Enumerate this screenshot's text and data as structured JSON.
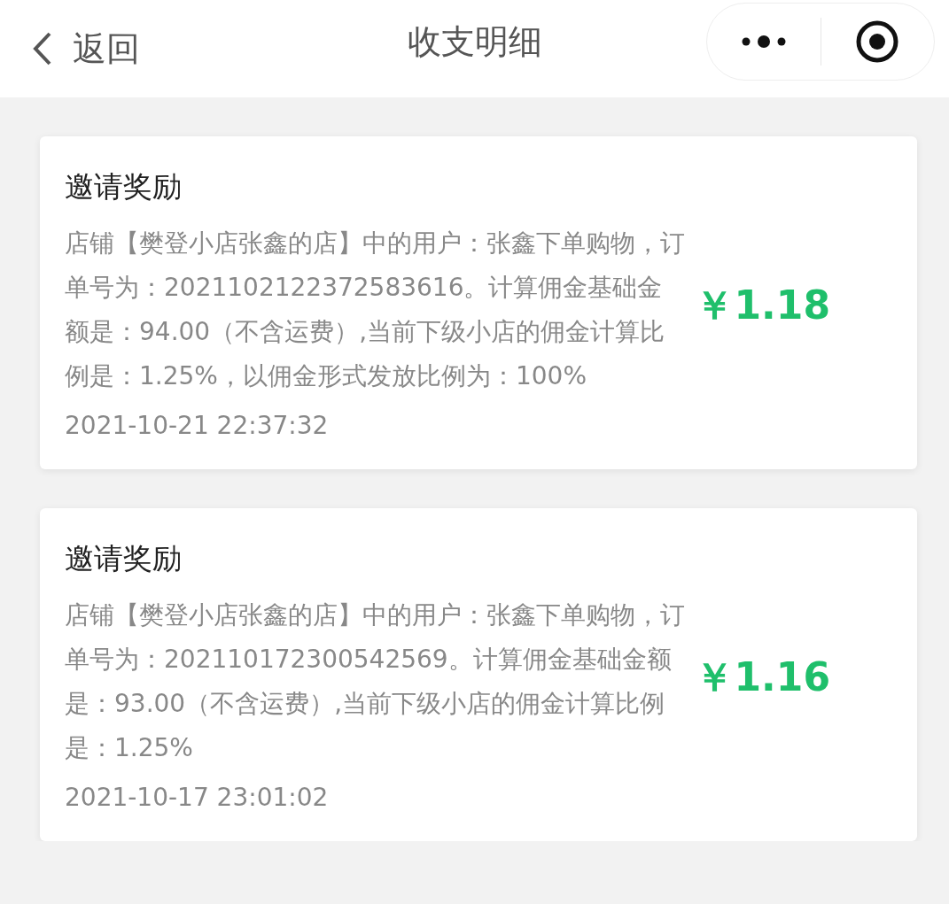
{
  "nav": {
    "back": "返回",
    "title": "收支明细"
  },
  "records": [
    {
      "title": "邀请奖励",
      "description": "店铺【樊登小店张鑫的店】中的用户：张鑫下单购物，订单号为：2021102122372583616。计算佣金基础金额是：94.00（不含运费）,当前下级小店的佣金计算比例是：1.25%，以佣金形式发放比例为：100%",
      "time": "2021-10-21 22:37:32",
      "amount": "￥1.18"
    },
    {
      "title": "邀请奖励",
      "description": "店铺【樊登小店张鑫的店】中的用户：张鑫下单购物，订单号为：202110172300542569。计算佣金基础金额是：93.00（不含运费）,当前下级小店的佣金计算比例是：1.25%",
      "time": "2021-10-17 23:01:02",
      "amount": "￥1.16"
    }
  ]
}
